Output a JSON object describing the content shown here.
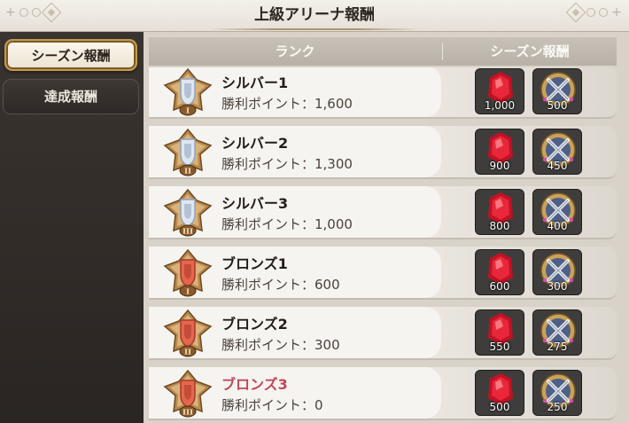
{
  "header": {
    "title": "上級アリーナ報酬"
  },
  "sidebar": {
    "tabs": [
      {
        "label": "シーズン報酬",
        "active": true
      },
      {
        "label": "達成報酬",
        "active": false
      }
    ]
  },
  "table": {
    "columns": {
      "rank": "ランク",
      "reward": "シーズン報酬"
    },
    "rows": [
      {
        "name": "シルバー1",
        "points": "勝利ポイント：1,600",
        "tier": "silver",
        "numeral": "I",
        "rewards": [
          "1,000",
          "500"
        ],
        "highlight": false
      },
      {
        "name": "シルバー2",
        "points": "勝利ポイント：1,300",
        "tier": "silver",
        "numeral": "II",
        "rewards": [
          "900",
          "450"
        ],
        "highlight": false
      },
      {
        "name": "シルバー3",
        "points": "勝利ポイント：1,000",
        "tier": "silver",
        "numeral": "III",
        "rewards": [
          "800",
          "400"
        ],
        "highlight": false
      },
      {
        "name": "ブロンズ1",
        "points": "勝利ポイント：600",
        "tier": "bronze",
        "numeral": "I",
        "rewards": [
          "600",
          "300"
        ],
        "highlight": false
      },
      {
        "name": "ブロンズ2",
        "points": "勝利ポイント：300",
        "tier": "bronze",
        "numeral": "II",
        "rewards": [
          "550",
          "275"
        ],
        "highlight": false
      },
      {
        "name": "ブロンズ3",
        "points": "勝利ポイント：0",
        "tier": "bronze",
        "numeral": "III",
        "rewards": [
          "500",
          "250"
        ],
        "highlight": true
      }
    ]
  },
  "icons": {
    "reward_1": "red-gem-icon",
    "reward_2": "crossed-swords-medal-icon"
  },
  "colors": {
    "accent_gold": "#c39a4d",
    "highlight_text": "#c0485a",
    "gem_red": "#d8192c"
  }
}
